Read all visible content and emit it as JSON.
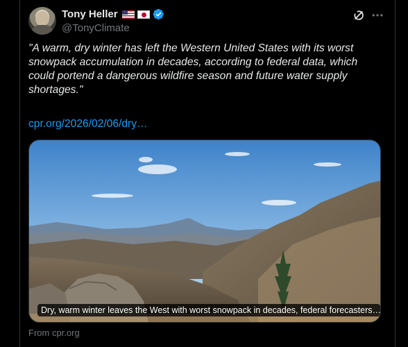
{
  "author": {
    "display_name": "Tony Heller",
    "handle": "@TonyClimate",
    "flags": [
      "us-flag-icon",
      "japan-flag-icon"
    ],
    "verified_icon": "verified-badge-icon"
  },
  "icons": {
    "grok": "grok-icon",
    "more": "more-options-icon"
  },
  "tweet": {
    "text": "\"A warm, dry winter has left the Western United States with its worst snowpack accumulation in decades, according to federal data, which could portend a dangerous wildfire season and future water supply shortages.\"",
    "link_text": "cpr.org/2026/02/06/dry…"
  },
  "card": {
    "image_description_icon": "mountain-landscape-image",
    "caption": "Dry, warm winter leaves the West with worst snowpack in decades, federal forecasters…",
    "source": "From cpr.org"
  },
  "colors": {
    "background": "#000000",
    "text": "#e7e9ea",
    "secondary_text": "#71767b",
    "link": "#1d9bf0",
    "verified": "#1d9bf0"
  }
}
